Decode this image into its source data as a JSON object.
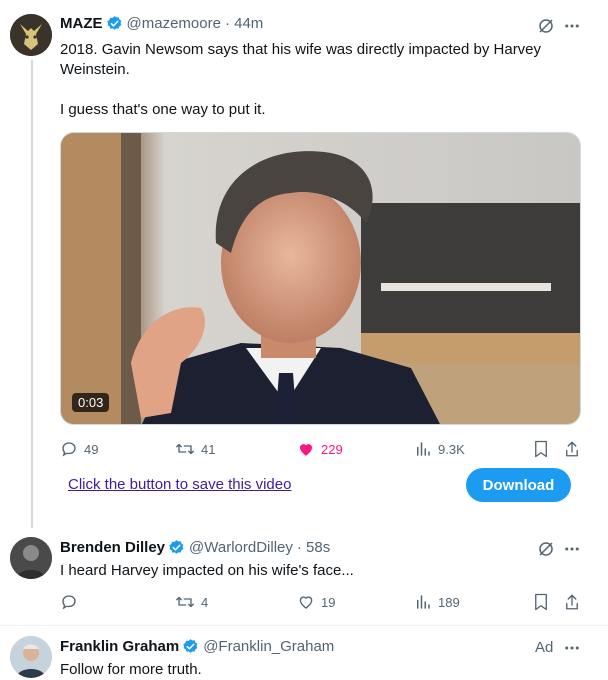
{
  "tweet1": {
    "name": "MAZE",
    "handle": "@mazemoore",
    "time": "· 44m",
    "text_line1": "2018. Gavin Newsom says that his wife was directly impacted by Harvey",
    "text_line2": "Weinstein.",
    "text_line3": "I guess that's one way to put it.",
    "video_time": "0:03",
    "replies": "49",
    "retweets": "41",
    "likes": "229",
    "views": "9.3K",
    "save_link": "Click the button to save this video",
    "download_label": "Download"
  },
  "tweet2": {
    "name": "Brenden Dilley",
    "handle": "@WarlordDilley",
    "time": "· 58s",
    "text": "I heard Harvey impacted on his wife's face...",
    "replies": "",
    "retweets": "4",
    "likes": "19",
    "views": "189"
  },
  "tweet3": {
    "name": "Franklin Graham",
    "handle": "@Franklin_Graham",
    "ad_label": "Ad",
    "text": "Follow for more truth."
  },
  "colors": {
    "accent": "#1d9bf0",
    "like_active": "#f91880",
    "muted": "#536471"
  }
}
